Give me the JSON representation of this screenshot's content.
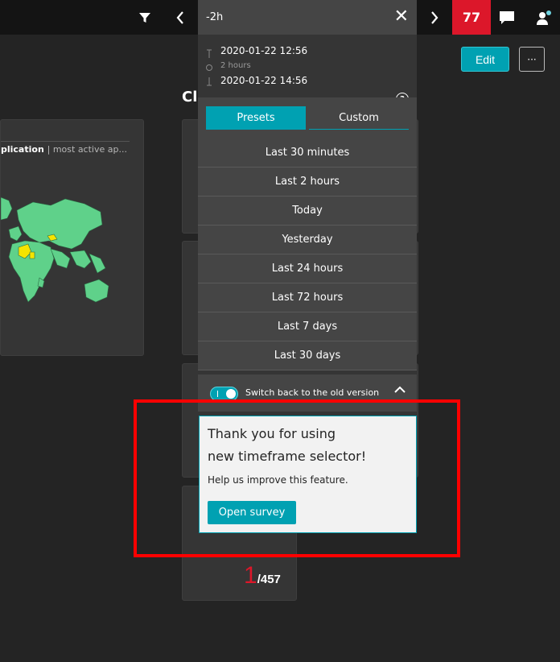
{
  "topbar": {
    "filter_icon": "filter-icon",
    "prev_icon": "chevron-left-icon",
    "next_icon": "chevron-right-icon",
    "problems_count": "77",
    "chat_icon": "chat-icon",
    "user_icon": "user-icon"
  },
  "dashboard": {
    "edit_label": "Edit",
    "more_label": "···",
    "section_title": "Cl",
    "map_tile": {
      "title": "plication",
      "subtitle": "| most active ap..."
    },
    "counter": {
      "current": "1",
      "total": "/457"
    }
  },
  "timeframe": {
    "input_value": "-2h",
    "from": "2020-01-22 12:56",
    "duration": "2 hours",
    "to": "2020-01-22 14:56",
    "tabs": [
      "Presets",
      "Custom"
    ],
    "presets": [
      "Last 30 minutes",
      "Last 2 hours",
      "Today",
      "Yesterday",
      "Last 24 hours",
      "Last 72 hours",
      "Last 7 days",
      "Last 30 days"
    ],
    "switch_label": "Switch back to the old version"
  },
  "survey": {
    "title_line1": "Thank you for using",
    "title_line2": "new timeframe selector!",
    "text": "Help us improve this feature.",
    "button": "Open survey"
  },
  "colors": {
    "accent": "#00a1b2",
    "alert": "#dc172a",
    "highlight": "#ff0000",
    "map_land": "#5fd18a",
    "map_hot": "#f5e400"
  }
}
